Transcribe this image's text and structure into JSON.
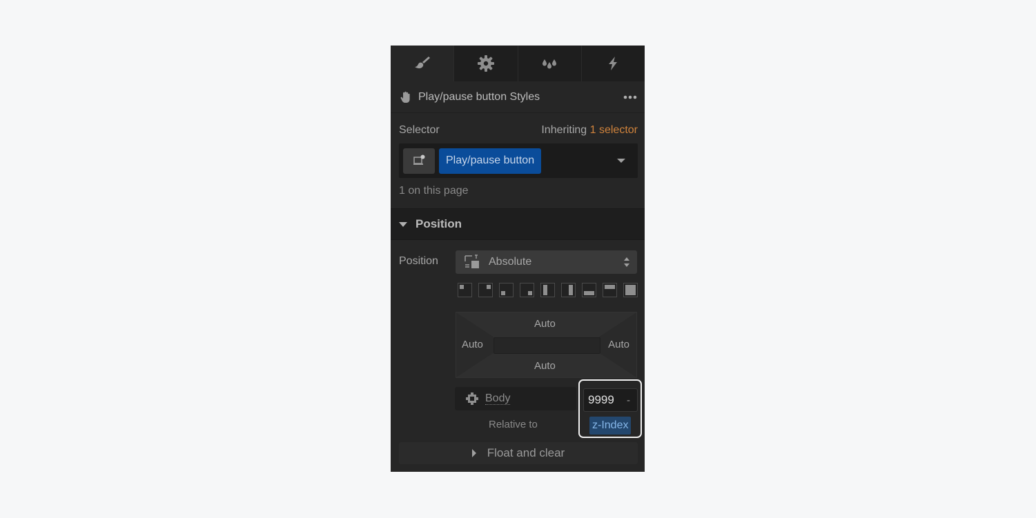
{
  "tabs": [
    {
      "id": "style",
      "icon": "paintbrush-icon",
      "active": true
    },
    {
      "id": "settings",
      "icon": "gear-icon",
      "active": false
    },
    {
      "id": "style-manager",
      "icon": "drops-icon",
      "active": false
    },
    {
      "id": "interactions",
      "icon": "lightning-icon",
      "active": false
    }
  ],
  "styles_header": {
    "icon": "hand-pointer-icon",
    "title": "Play/pause button Styles",
    "more_icon": "more-dots-icon"
  },
  "selector": {
    "label": "Selector",
    "inheriting_prefix": "Inheriting",
    "inheriting_count": "1 selector",
    "class_pill": "Play/pause button",
    "usage": "1 on this page",
    "accent_colors": {
      "pill": "#0a4c9a",
      "inheriting": "#d0833c"
    }
  },
  "position_section": {
    "title": "Position",
    "field_label": "Position",
    "value": "Absolute",
    "presets": [
      "top-left",
      "top-right",
      "bottom-left",
      "bottom-right",
      "left",
      "right",
      "bottom",
      "top",
      "full"
    ],
    "offsets": {
      "top": "Auto",
      "left": "Auto",
      "right": "Auto",
      "bottom": "Auto"
    },
    "relative_to": {
      "value": "Body",
      "caption": "Relative to"
    },
    "z_index": {
      "value": "9999",
      "suffix": "-",
      "label": "z-Index"
    }
  },
  "float_section": {
    "title": "Float and clear"
  }
}
